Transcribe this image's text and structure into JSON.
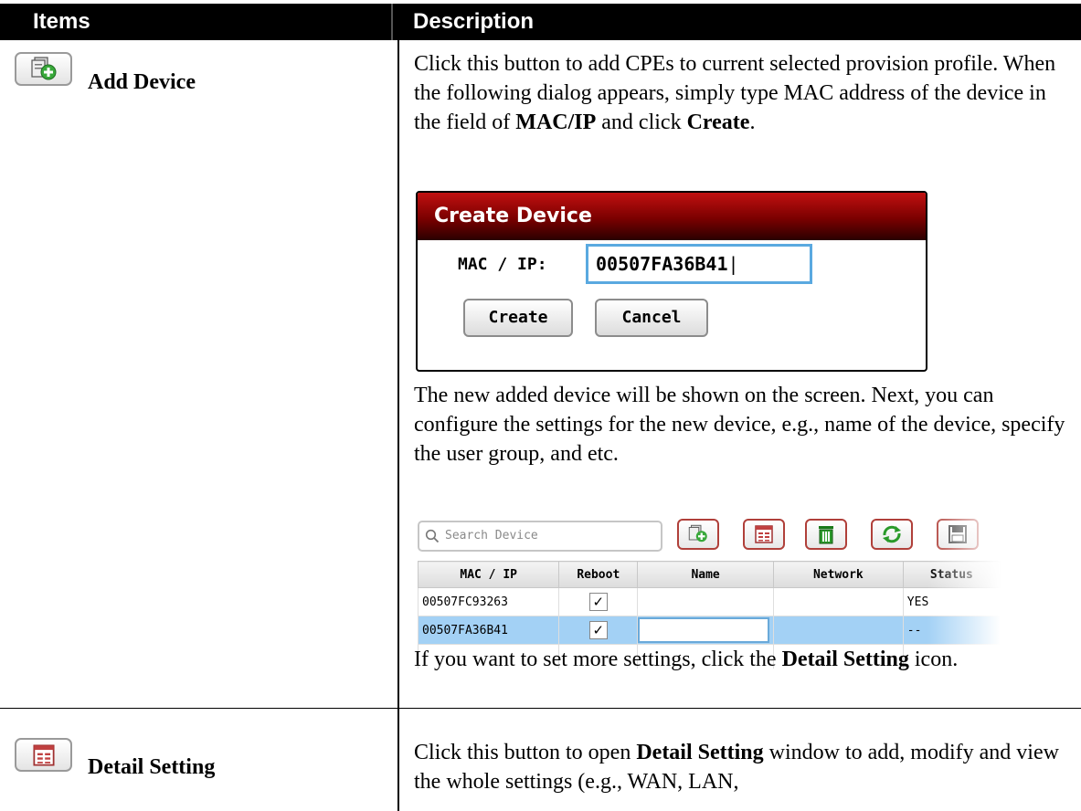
{
  "header": {
    "items": "Items",
    "description": "Description"
  },
  "rows": [
    {
      "item": "Add Device",
      "p1_a": "Click this button to add CPEs to current selected provision profile. When the following dialog appears, simply type MAC address of the device in the field of ",
      "p1_b": "MAC/IP",
      "p1_c": " and click ",
      "p1_d": "Create",
      "p1_e": ".",
      "p2": "The new added device will be shown on the screen. Next, you can configure the settings for the new device, e.g., name of the device, specify the user group, and etc.",
      "p3_a": "If you want to set more settings, click the ",
      "p3_b": "Detail Setting",
      "p3_c": " icon."
    },
    {
      "item": "Detail Setting",
      "p1_a": "Click this button to open ",
      "p1_b": "Detail Setting",
      "p1_c": " window to add, modify and view the whole settings (e.g., WAN, LAN,"
    }
  ],
  "dialog": {
    "title": "Create Device",
    "label": "MAC / IP:",
    "value": "00507FA36B41",
    "create": "Create",
    "cancel": "Cancel"
  },
  "grid": {
    "search_placeholder": "Search Device",
    "columns": [
      "MAC / IP",
      "Reboot",
      "Name",
      "Network",
      "Status"
    ],
    "rows": [
      {
        "mac": "00507FC93263",
        "reboot": "✓",
        "status": "YES"
      },
      {
        "mac": "00507FA36B41",
        "reboot": "✓",
        "status": "--"
      }
    ]
  },
  "icons": [
    "add-device-icon",
    "detail-setting-icon",
    "delete-icon",
    "refresh-icon",
    "save-icon",
    "search-icon"
  ],
  "colors": {
    "dialog_title": "#8b0000",
    "input_focus": "#5aa9e0",
    "selected_row": "#a3d1f5",
    "toolbar_border": "#b0403a"
  }
}
